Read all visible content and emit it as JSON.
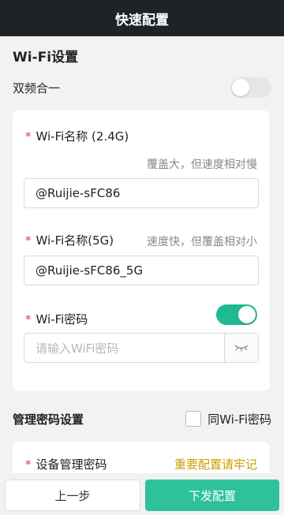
{
  "header": {
    "title": "快速配置"
  },
  "wifi_section": {
    "title": "Wi-Fi设置",
    "dual_band_label": "双频合一",
    "dual_band_on": false
  },
  "wifi_card": {
    "required_mark": "*",
    "ssid_24g_label": "Wi-Fi名称 (2.4G)",
    "ssid_24g_hint": "覆盖大，但速度相对慢",
    "ssid_24g_value": "@Ruijie-sFC86",
    "ssid_5g_label": "Wi-Fi名称(5G)",
    "ssid_5g_hint": "速度快，但覆盖相对小",
    "ssid_5g_value": "@Ruijie-sFC86_5G",
    "password_label": "Wi-Fi密码",
    "password_toggle_on": true,
    "password_placeholder": "请输入WiFi密码"
  },
  "admin_section": {
    "title": "管理密码设置",
    "same_as_wifi_label": "同Wi-Fi密码",
    "device_password_label": "设备管理密码",
    "device_password_note": "重要配置请牢记",
    "note_color": "#c8a000"
  },
  "footer": {
    "prev_label": "上一步",
    "next_label": "下发配置"
  },
  "colors": {
    "accent": "#2ec29a",
    "header_bg": "#1f2327",
    "required": "#e33b3b"
  }
}
